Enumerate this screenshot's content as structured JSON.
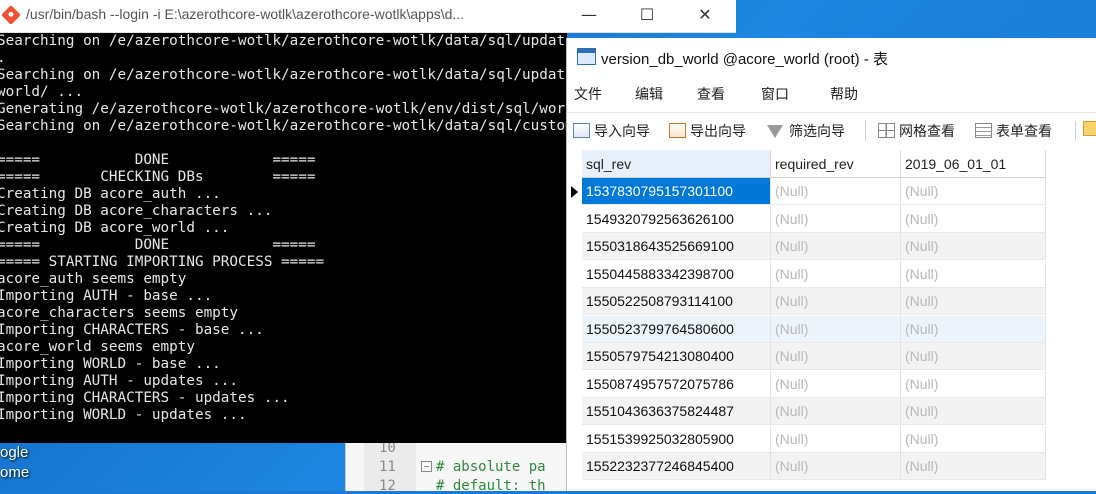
{
  "desktop": {
    "labels": [
      "ogle",
      "ome"
    ]
  },
  "editor": {
    "lines": [
      {
        "num": "10",
        "code": ""
      },
      {
        "num": "11",
        "code": "# absolute pa"
      },
      {
        "num": "12",
        "code": "# default: th"
      }
    ]
  },
  "terminal": {
    "title": "/usr/bin/bash --login -i E:\\azerothcore-wotlk\\azerothcore-wotlk\\apps\\d...",
    "minimize": "—",
    "maximize": "☐",
    "close": "✕",
    "lines": [
      "Searching on /e/azerothcore-wotlk/azerothcore-wotlk/data/sql/updates/db_world/",
      ".",
      "Searching on /e/azerothcore-wotlk/azerothcore-wotlk/data/sql/updates/pending_db_",
      "world/ ...",
      "Generating /e/azerothcore-wotlk/azerothcore-wotlk/env/dist/sql/world_updates.sql",
      "Searching on /e/azerothcore-wotlk/azerothcore-wotlk/data/sql/custom/db_world/ ...",
      "",
      "=====           DONE            =====",
      "=====       CHECKING DBs        =====",
      "Creating DB acore_auth ...",
      "Creating DB acore_characters ...",
      "Creating DB acore_world ...",
      "=====           DONE            =====",
      "===== STARTING IMPORTING PROCESS =====",
      "acore_auth seems empty",
      "Importing AUTH - base ...",
      "acore_characters seems empty",
      "Importing CHARACTERS - base ...",
      "acore_world seems empty",
      "Importing WORLD - base ...",
      "Importing AUTH - updates ...",
      "Importing CHARACTERS - updates ...",
      "Importing WORLD - updates ..."
    ]
  },
  "navicat": {
    "title": "version_db_world @acore_world (root) - 表",
    "menu": [
      "文件",
      "编辑",
      "查看",
      "窗口",
      "帮助"
    ],
    "toolbar": {
      "import": "导入向导",
      "export": "导出向导",
      "filter": "筛选向导",
      "grid": "网格查看",
      "form": "表单查看"
    },
    "columns": [
      "sql_rev",
      "required_rev",
      "2019_06_01_01"
    ],
    "rows": [
      [
        "1537830795157301100",
        "(Null)",
        "(Null)"
      ],
      [
        "1549320792563626100",
        "(Null)",
        "(Null)"
      ],
      [
        "1550318643525669100",
        "(Null)",
        "(Null)"
      ],
      [
        "1550445883342398700",
        "(Null)",
        "(Null)"
      ],
      [
        "1550522508793114100",
        "(Null)",
        "(Null)"
      ],
      [
        "1550523799764580600",
        "(Null)",
        "(Null)"
      ],
      [
        "1550579754213080400",
        "(Null)",
        "(Null)"
      ],
      [
        "1550874957572075786",
        "(Null)",
        "(Null)"
      ],
      [
        "1551043636375824487",
        "(Null)",
        "(Null)"
      ],
      [
        "1551539925032805900",
        "(Null)",
        "(Null)"
      ],
      [
        "1552232377246845400",
        "(Null)",
        "(Null)"
      ]
    ]
  }
}
